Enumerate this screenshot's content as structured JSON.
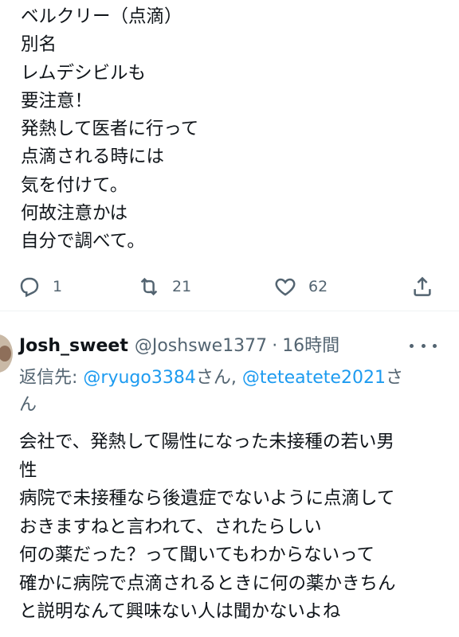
{
  "tweet1": {
    "lines": [
      "ベルクリー（点滴）",
      "別名",
      "レムデシビルも",
      "要注意！",
      "発熱して医者に行って",
      "点滴される時には",
      "気を付けて。",
      "何故注意かは",
      "自分で調べて。"
    ],
    "actions": {
      "reply_icon": "reply-icon",
      "reply_count": "1",
      "retweet_icon": "retweet-icon",
      "retweet_count": "21",
      "like_icon": "heart-icon",
      "like_count": "62",
      "share_icon": "share-icon"
    }
  },
  "tweet2": {
    "display_name": "Josh_sweet",
    "handle": "@Joshswe1377",
    "separator": "·",
    "time": "16時間",
    "more_icon": "more-icon",
    "reply_prefix": "返信先: ",
    "mention1": "@ryugo3384",
    "san1": "さん",
    "comma": ", ",
    "mention2": "@teteatete2021",
    "san2a": "さ",
    "san2b": "ん",
    "lines": [
      "会社で、発熱して陽性になった未接種の若い男",
      "性",
      "病院で未接種なら後遺症でないように点滴して",
      "おきますねと言われて、されたらしい",
      "何の薬だった？って聞いてもわからないって",
      "確かに病院で点滴されるときに何の薬かきちん",
      "と説明なんて興味ない人は聞かないよね"
    ]
  },
  "colors": {
    "text": "#0f1419",
    "secondary": "#536471",
    "link": "#1d9bf0"
  }
}
